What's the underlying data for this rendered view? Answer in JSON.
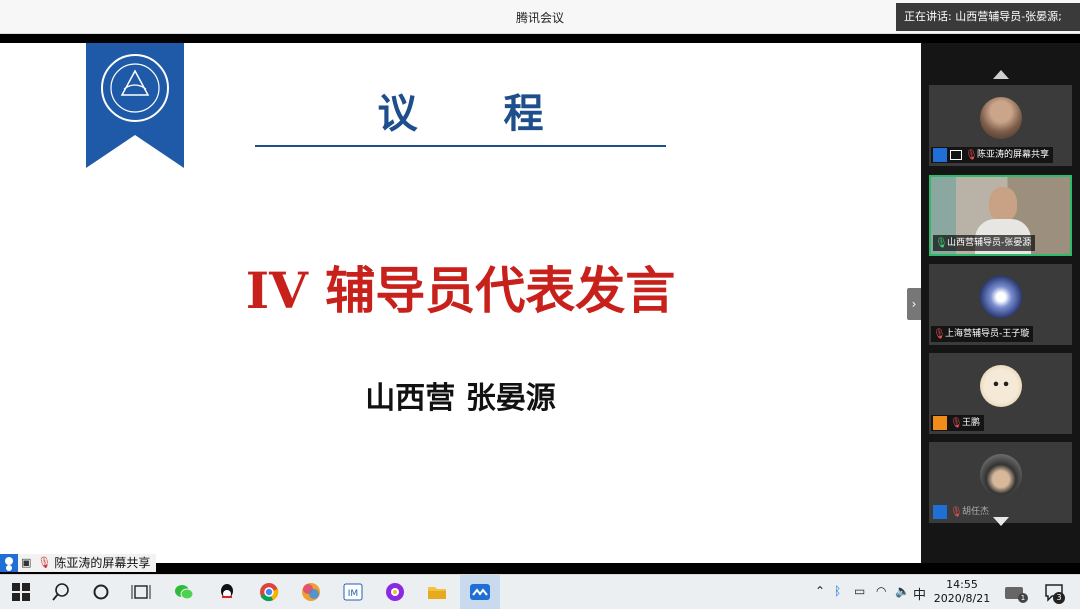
{
  "window": {
    "title": "腾讯会议",
    "speaking": "正在讲话: 山西营辅导员-张晏源;"
  },
  "slide": {
    "agenda_title": "议 程",
    "headline_roman": "IV",
    "headline_text": "辅导员代表发言",
    "speaker": "山西营 张晏源"
  },
  "share_label": "陈亚涛的屏幕共享",
  "participants": [
    {
      "name": "陈亚涛的屏幕共享"
    },
    {
      "name": "山西营辅导员-张晏源"
    },
    {
      "name": "上海营辅导员-王子璇"
    },
    {
      "name": "王鹏"
    },
    {
      "name": "胡任杰"
    }
  ],
  "taskbar": {
    "ime": "中",
    "time": "14:55",
    "date": "2020/8/21",
    "notification_count": "3",
    "badge_1": "1"
  },
  "colors": {
    "accent_blue": "#1f4e8c",
    "headline_red": "#c8201b",
    "active_border": "#2dbb6b"
  }
}
